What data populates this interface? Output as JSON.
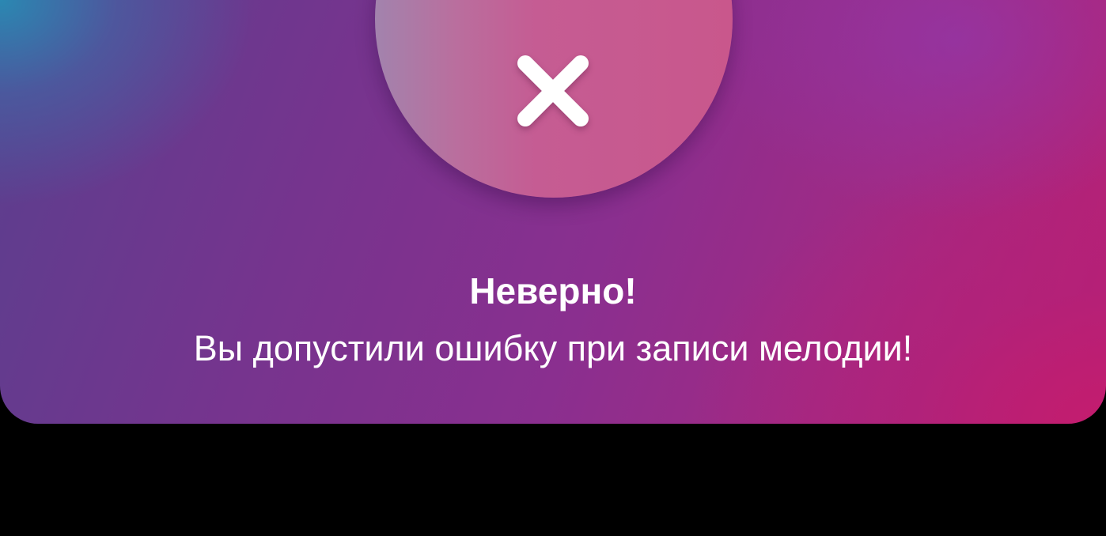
{
  "dialog": {
    "title": "Неверно!",
    "message": "Вы допустили ошибку при записи мелодии!",
    "icon": "close-icon"
  },
  "colors": {
    "panel_gradient_start": "#2f8fb0",
    "panel_gradient_mid": "#7a338e",
    "panel_gradient_end": "#c21d6e",
    "badge_left": "#a283ad",
    "badge_right": "#c9578c",
    "text": "#ffffff",
    "backdrop": "#000000"
  }
}
